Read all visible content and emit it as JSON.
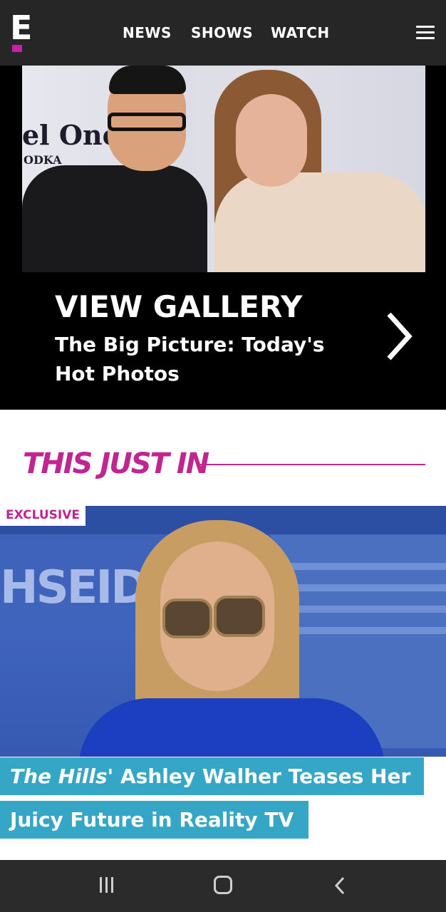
{
  "header": {
    "logo_text": "E",
    "brand_color": "#c91ea8",
    "nav": [
      "NEWS",
      "SHOWS",
      "WATCH"
    ],
    "menu_icon": "hamburger-menu-icon"
  },
  "gallery": {
    "photo_text_1": "el One",
    "photo_text_2": "ODKA",
    "title": "VIEW GALLERY",
    "subtitle": "The Big Picture: Today's Hot Photos",
    "arrow_icon": "chevron-right-icon"
  },
  "section": {
    "title": "THIS JUST IN",
    "accent_color": "#c02592"
  },
  "article": {
    "badge": "EXCLUSIVE",
    "photo_sign_text": "HSEIDO",
    "headline_show": "The Hills",
    "headline_line1_rest": "' Ashley Walher Teases Her",
    "headline_line2": "Juicy Future in Reality TV",
    "headline_bg": "#35a6c5"
  },
  "system_nav": {
    "recents_icon": "recent-apps-icon",
    "home_icon": "home-icon",
    "back_icon": "back-icon"
  }
}
